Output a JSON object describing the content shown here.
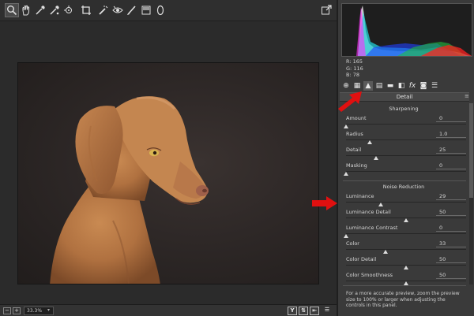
{
  "toolbar": {
    "tools": [
      "zoom-tool",
      "hand-tool",
      "white-balance-tool",
      "color-sampler-tool",
      "crop-tool",
      "straighten-tool",
      "red-eye-tool",
      "adjustment-brush-tool",
      "graduated-filter-tool",
      "radial-filter-tool"
    ],
    "open_label": "⇱"
  },
  "histogram": {
    "r_label": "R:",
    "r_value": "165",
    "g_label": "G:",
    "g_value": "116",
    "b_label": "B:",
    "b_value": "78"
  },
  "panel": {
    "title": "Detail",
    "sharpening": {
      "header": "Sharpening",
      "sliders": [
        {
          "label": "Amount",
          "value": "0",
          "position": 0.0
        },
        {
          "label": "Radius",
          "value": "1.0",
          "position": 0.2
        },
        {
          "label": "Detail",
          "value": "25",
          "position": 0.25
        },
        {
          "label": "Masking",
          "value": "0",
          "position": 0.0
        }
      ]
    },
    "noise_reduction": {
      "header": "Noise Reduction",
      "sliders": [
        {
          "label": "Luminance",
          "value": "29",
          "position": 0.29
        },
        {
          "label": "Luminance Detail",
          "value": "50",
          "position": 0.5
        },
        {
          "label": "Luminance Contrast",
          "value": "0",
          "position": 0.0
        },
        {
          "label": "Color",
          "value": "33",
          "position": 0.33
        },
        {
          "label": "Color Detail",
          "value": "50",
          "position": 0.5
        },
        {
          "label": "Color Smoothness",
          "value": "50",
          "position": 0.5
        }
      ]
    },
    "note": "For a more accurate preview, zoom the preview size to 100% or larger when adjusting the controls in this panel."
  },
  "bottombar": {
    "zoom_out": "−",
    "zoom_in": "+",
    "zoom_value": "33.3%",
    "view_y_label": "Y"
  },
  "colors": {
    "accent_arrow": "#e01010",
    "panel_bg": "#3a3a3a",
    "canvas_bg": "#2b2b2b"
  }
}
